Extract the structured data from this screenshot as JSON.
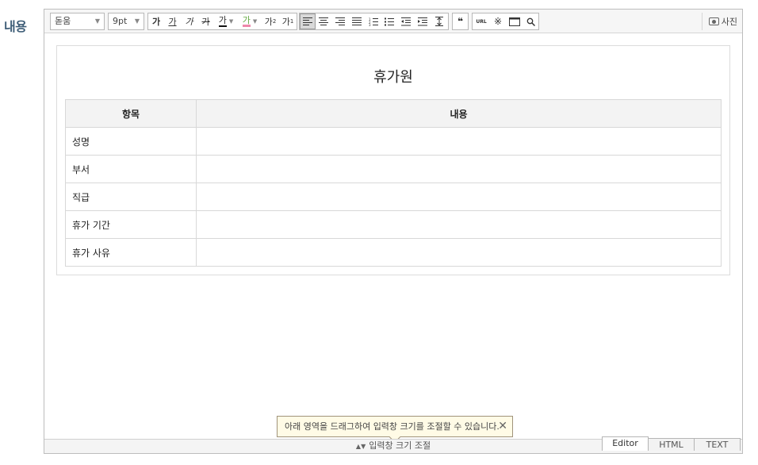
{
  "field_label": "내용",
  "toolbar": {
    "font_family": "돋움",
    "font_size": "9pt",
    "text_buttons": [
      "가",
      "가",
      "가",
      "가",
      "가",
      "가",
      "가",
      "가",
      "가"
    ],
    "quote_label": "❝",
    "url_label": "URL",
    "special_char_label": "※",
    "photo_label": "사진",
    "icons": [
      "bold",
      "underline",
      "italic",
      "strikethrough",
      "font-color",
      "background-color",
      "superscript",
      "subscript",
      "align-left",
      "align-center",
      "align-right",
      "align-justify",
      "ordered-list",
      "unordered-list",
      "outdent",
      "indent",
      "line-height",
      "quote",
      "url-link",
      "special-char",
      "table",
      "search",
      "camera"
    ]
  },
  "document": {
    "title": "휴가원",
    "headers": [
      "항목",
      "내용"
    ],
    "rows": [
      [
        "성명",
        ""
      ],
      [
        "부서",
        ""
      ],
      [
        "직급",
        ""
      ],
      [
        "휴가 기간",
        ""
      ],
      [
        "휴가 사유",
        ""
      ]
    ]
  },
  "tooltip": {
    "text": "아래 영역을 드래그하여 입력창 크기를 조절할 수 있습니다.",
    "close": "✕"
  },
  "resize_label": "입력창 크기 조절",
  "mode_tabs": [
    "Editor",
    "HTML",
    "TEXT"
  ],
  "active_mode": "Editor"
}
